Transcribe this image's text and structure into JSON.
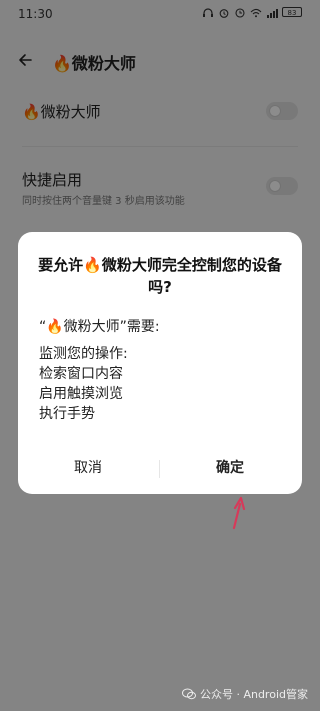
{
  "status": {
    "time": "11:30",
    "battery": "83",
    "icons": [
      "headset-icon",
      "alarm-icon",
      "clock-icon",
      "wifi-icon",
      "signal-icon"
    ]
  },
  "header": {
    "title": "🔥微粉大师"
  },
  "settings": {
    "row1_label": "🔥微粉大师",
    "row2_label": "快捷启用",
    "row2_sub": "同时按住两个音量键 3 秒启用该功能"
  },
  "dialog": {
    "title": "要允许🔥微粉大师完全控制您的设备吗?",
    "sub": "“🔥微粉大师”需要:",
    "items": [
      "监测您的操作:",
      "检索窗口内容",
      "启用触摸浏览",
      "执行手势"
    ],
    "cancel": "取消",
    "ok": "确定"
  },
  "watermark": "公众号 · Android管家",
  "colors": {
    "arrow": "#d63a5a",
    "overlay": "rgba(0,0,0,0.45)"
  }
}
